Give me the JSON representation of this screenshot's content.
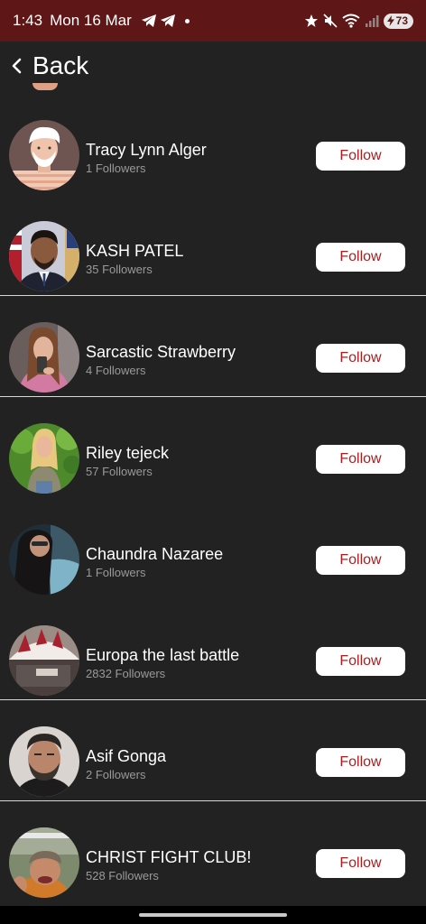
{
  "status_bar": {
    "time": "1:43",
    "date": "Mon 16 Mar",
    "battery": "73"
  },
  "header": {
    "back_label": "Back"
  },
  "users": [
    {
      "name": "Tracy Lynn Alger",
      "followers": "1 Followers",
      "button": "Follow",
      "avatar": "cartoon-avatar"
    },
    {
      "name": "KASH PATEL",
      "followers": "35 Followers",
      "button": "Follow",
      "avatar": "man-suit"
    },
    {
      "name": "Sarcastic Strawberry",
      "followers": "4 Followers",
      "button": "Follow",
      "avatar": "woman-selfie"
    },
    {
      "name": "Riley tejeck",
      "followers": "57 Followers",
      "button": "Follow",
      "avatar": "woman-outdoors"
    },
    {
      "name": "Chaundra Nazaree",
      "followers": "1 Followers",
      "button": "Follow",
      "avatar": "woman-dark"
    },
    {
      "name": "Europa the last battle",
      "followers": "2832 Followers",
      "button": "Follow",
      "avatar": "roof-pom"
    },
    {
      "name": "Asif Gonga",
      "followers": "2 Followers",
      "button": "Follow",
      "avatar": "man-beard"
    },
    {
      "name": "CHRIST FIGHT CLUB!",
      "followers": "528 Followers",
      "button": "Follow",
      "avatar": "man-selfie"
    }
  ],
  "colors": {
    "status_bar_bg": "#5e1616",
    "background": "#222222",
    "follow_text": "#b01c1c"
  }
}
